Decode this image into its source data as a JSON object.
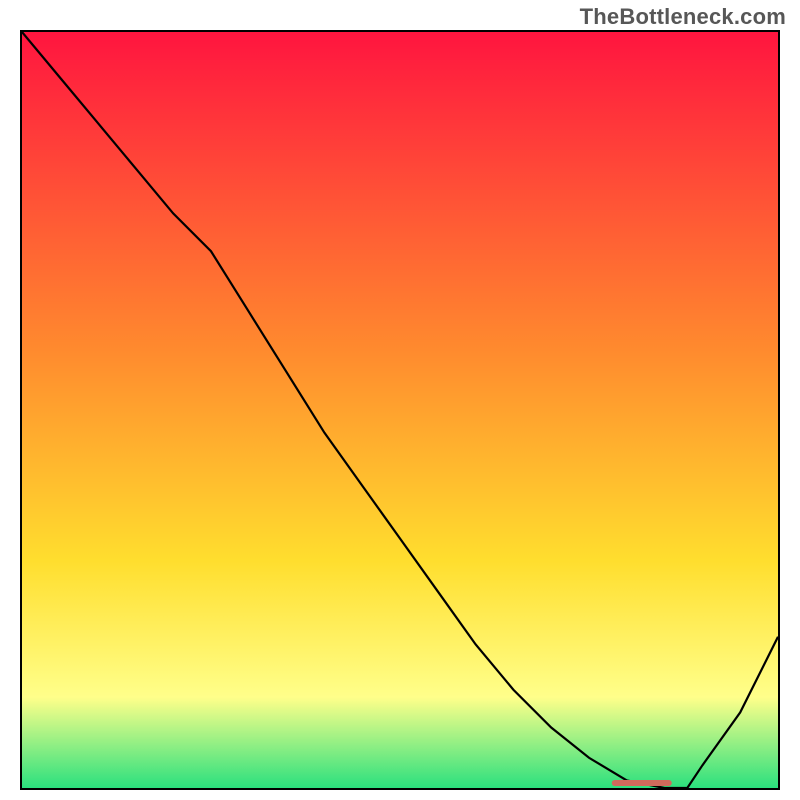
{
  "watermark": "TheBottleneck.com",
  "colors": {
    "top": "#ff153f",
    "mid1": "#ff8a2e",
    "mid2": "#ffde2e",
    "mid3": "#ffff8a",
    "bottom": "#2be07e",
    "curve": "#000000",
    "marker": "#d06a5c",
    "frame": "#000000"
  },
  "chart_data": {
    "type": "line",
    "title": "",
    "xlabel": "",
    "ylabel": "",
    "xlim": [
      0,
      100
    ],
    "ylim": [
      0,
      100
    ],
    "x": [
      0,
      5,
      10,
      15,
      20,
      25,
      30,
      35,
      40,
      45,
      50,
      55,
      60,
      65,
      70,
      75,
      80,
      85,
      88,
      90,
      95,
      100
    ],
    "values": [
      100,
      94,
      88,
      82,
      76,
      71,
      63,
      55,
      47,
      40,
      33,
      26,
      19,
      13,
      8,
      4,
      1,
      0,
      0,
      3,
      10,
      20
    ],
    "marker": {
      "x_start": 78,
      "x_end": 86,
      "y": 0
    },
    "annotations": []
  }
}
